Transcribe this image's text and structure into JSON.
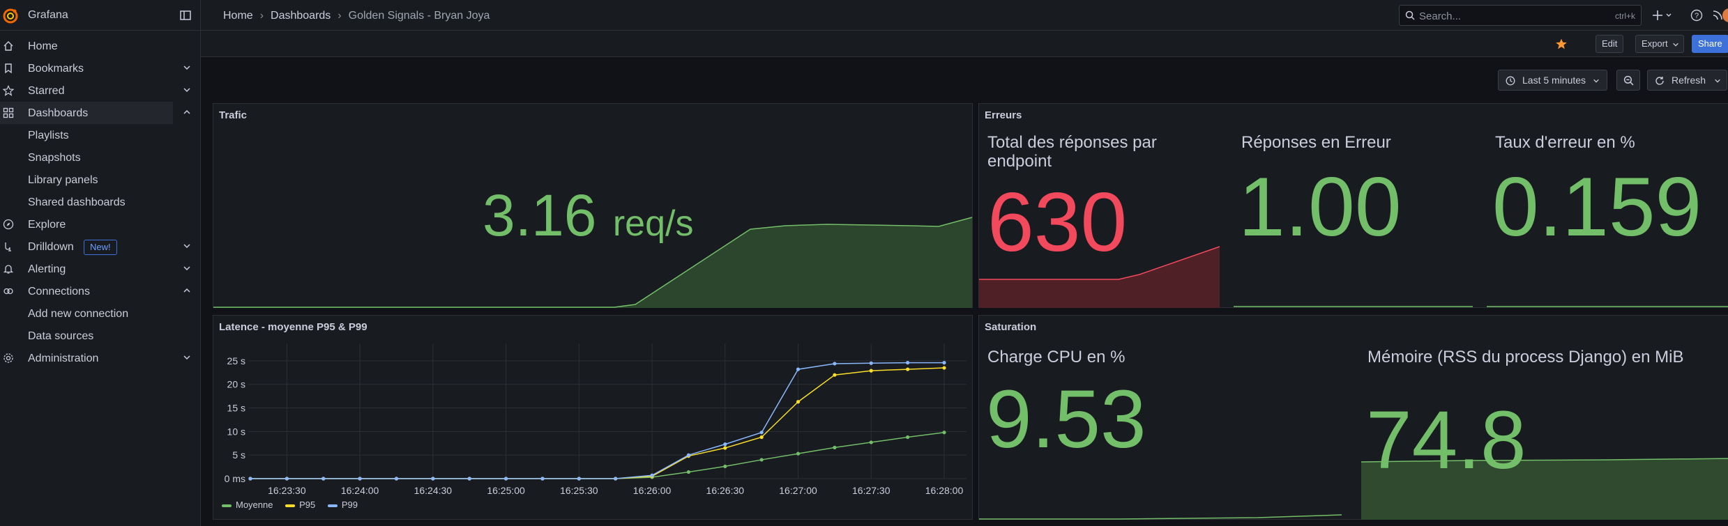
{
  "app": {
    "name": "Grafana"
  },
  "breadcrumb": {
    "home": "Home",
    "dashboards": "Dashboards",
    "current": "Golden Signals - Bryan Joya"
  },
  "search": {
    "placeholder": "Search...",
    "shortcut": "ctrl+k"
  },
  "sidebar": {
    "items": [
      {
        "label": "Home",
        "icon": "home-icon"
      },
      {
        "label": "Bookmarks",
        "icon": "bookmark-icon"
      },
      {
        "label": "Starred",
        "icon": "star-icon"
      },
      {
        "label": "Dashboards",
        "icon": "apps-icon"
      },
      {
        "label": "Playlists"
      },
      {
        "label": "Snapshots"
      },
      {
        "label": "Library panels"
      },
      {
        "label": "Shared dashboards"
      },
      {
        "label": "Explore",
        "icon": "compass-icon"
      },
      {
        "label": "Drilldown",
        "icon": "drilldown-icon",
        "badge": "New!"
      },
      {
        "label": "Alerting",
        "icon": "bell-icon"
      },
      {
        "label": "Connections",
        "icon": "link-icon"
      },
      {
        "label": "Add new connection"
      },
      {
        "label": "Data sources"
      },
      {
        "label": "Administration",
        "icon": "gear-icon"
      }
    ]
  },
  "toolbar": {
    "edit": "Edit",
    "export": "Export",
    "share": "Share",
    "timerange": "Last 5 minutes",
    "refresh": "Refresh"
  },
  "panels": {
    "trafic": {
      "title": "Trafic",
      "value": "3.16",
      "unit": "req/s"
    },
    "erreurs": {
      "title": "Erreurs",
      "stats": [
        {
          "title": "Total des réponses par endpoint",
          "value": "630",
          "color": "#f2495c"
        },
        {
          "title": "Réponses en Erreur",
          "value": "1.00",
          "color": "#73bf69"
        },
        {
          "title": "Taux d'erreur en %",
          "value": "0.159",
          "color": "#73bf69"
        }
      ]
    },
    "latence": {
      "title": "Latence - moyenne P95 & P99"
    },
    "saturation": {
      "title": "Saturation",
      "stats": [
        {
          "title": "Charge CPU en %",
          "value": "9.53"
        },
        {
          "title": "Mémoire (RSS du process Django) en MiB",
          "value": "74.8"
        }
      ]
    }
  },
  "chart_data": {
    "type": "line",
    "x": [
      "16:23:15",
      "16:23:30",
      "16:23:45",
      "16:24:00",
      "16:24:15",
      "16:24:30",
      "16:24:45",
      "16:25:00",
      "16:25:15",
      "16:25:30",
      "16:25:45",
      "16:26:00",
      "16:26:15",
      "16:26:30",
      "16:26:45",
      "16:27:00",
      "16:27:15",
      "16:27:30",
      "16:27:45",
      "16:28:00"
    ],
    "xticks": [
      "16:23:30",
      "16:24:00",
      "16:24:30",
      "16:25:00",
      "16:25:30",
      "16:26:00",
      "16:26:30",
      "16:27:00",
      "16:27:30",
      "16:28:00"
    ],
    "yticks": [
      "0 ms",
      "5 s",
      "10 s",
      "15 s",
      "20 s",
      "25 s"
    ],
    "ylim": [
      0,
      27.5
    ],
    "series": [
      {
        "name": "Moyenne",
        "color": "#73bf69",
        "values": [
          0,
          0,
          0,
          0,
          0,
          0,
          0,
          0,
          0,
          0,
          0,
          0.3,
          1.4,
          2.6,
          4.0,
          5.3,
          6.6,
          7.7,
          8.8,
          9.8
        ]
      },
      {
        "name": "P95",
        "color": "#fade2a",
        "values": [
          0,
          0,
          0,
          0,
          0,
          0,
          0,
          0,
          0,
          0,
          0,
          0.5,
          4.8,
          6.5,
          8.8,
          16.3,
          22.0,
          22.9,
          23.2,
          23.5
        ]
      },
      {
        "name": "P99",
        "color": "#8ab8ff",
        "values": [
          0,
          0,
          0,
          0,
          0,
          0,
          0,
          0,
          0,
          0,
          0,
          0.7,
          5.0,
          7.3,
          9.8,
          23.2,
          24.4,
          24.5,
          24.6,
          24.6
        ]
      }
    ],
    "grid": true,
    "legend": "bottom-left"
  }
}
